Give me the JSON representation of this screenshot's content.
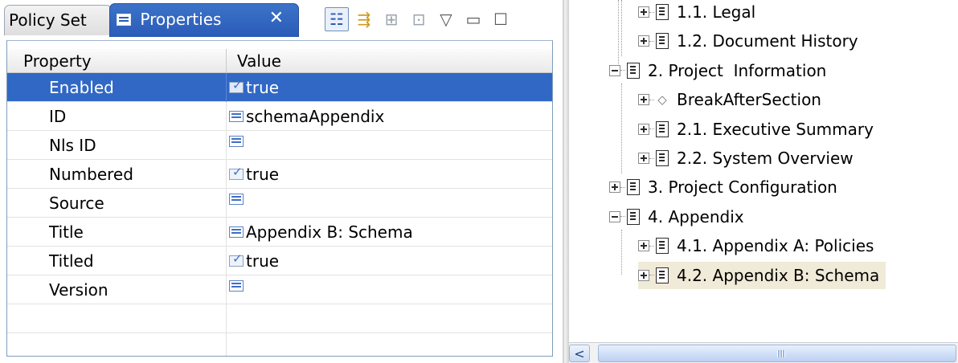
{
  "tabs": {
    "inactive_label": "Policy Set",
    "active_label": "Properties",
    "active_icon": "properties-list-icon",
    "close_glyph": "✕"
  },
  "toolbar": {
    "buttons": [
      {
        "name": "show-categories-icon",
        "glyph": "☷",
        "state": "pressed"
      },
      {
        "name": "show-advanced-icon",
        "glyph": "⇶",
        "state": "enabled"
      },
      {
        "name": "filter-icon",
        "glyph": "⊞",
        "state": "disabled"
      },
      {
        "name": "restore-default-icon",
        "glyph": "⊡",
        "state": "disabled"
      },
      {
        "name": "view-menu-icon",
        "glyph": "▽",
        "state": "enabled"
      },
      {
        "name": "minimize-icon",
        "glyph": "▭",
        "state": "enabled"
      },
      {
        "name": "maximize-icon",
        "glyph": "☐",
        "state": "enabled"
      }
    ]
  },
  "properties": {
    "columns": [
      "Property",
      "Value"
    ],
    "rows": [
      {
        "property": "Enabled",
        "value": "true",
        "icon": "boolean-icon",
        "selected": true
      },
      {
        "property": "ID",
        "value": "schemaAppendix",
        "icon": "text-icon",
        "selected": false
      },
      {
        "property": "Nls ID",
        "value": "",
        "icon": "text-icon",
        "selected": false
      },
      {
        "property": "Numbered",
        "value": "true",
        "icon": "boolean-icon",
        "selected": false
      },
      {
        "property": "Source",
        "value": "",
        "icon": "text-icon",
        "selected": false
      },
      {
        "property": "Title",
        "value": "Appendix B: Schema",
        "icon": "text-icon",
        "selected": false
      },
      {
        "property": "Titled",
        "value": "true",
        "icon": "boolean-icon",
        "selected": false
      },
      {
        "property": "Version",
        "value": "",
        "icon": "text-icon",
        "selected": false
      }
    ]
  },
  "outline": {
    "nodes": [
      {
        "label": "1.1. Legal",
        "level": 2,
        "toggle": "plus",
        "icon": "document-icon"
      },
      {
        "label": "1.2. Document History",
        "level": 2,
        "toggle": "plus",
        "icon": "document-icon"
      },
      {
        "label": "2. Project  Information",
        "level": 1,
        "toggle": "minus",
        "icon": "document-icon"
      },
      {
        "label": "BreakAfterSection",
        "level": 2,
        "toggle": "plus",
        "icon": "diamond-icon"
      },
      {
        "label": "2.1. Executive Summary",
        "level": 2,
        "toggle": "plus",
        "icon": "document-icon"
      },
      {
        "label": "2.2. System Overview",
        "level": 2,
        "toggle": "plus",
        "icon": "document-icon"
      },
      {
        "label": "3. Project Configuration",
        "level": 1,
        "toggle": "plus",
        "icon": "document-icon"
      },
      {
        "label": "4. Appendix",
        "level": 1,
        "toggle": "minus",
        "icon": "document-icon"
      },
      {
        "label": "4.1. Appendix A: Policies",
        "level": 2,
        "toggle": "plus",
        "icon": "document-icon"
      },
      {
        "label": "4.2. Appendix B: Schema",
        "level": 2,
        "toggle": "plus",
        "icon": "document-icon",
        "selected": true
      }
    ]
  },
  "scrollbar": {
    "left_arrow_glyph": "<"
  },
  "colors": {
    "selection": "#3168c5",
    "tab_active": "#2a5bb8",
    "tree_selection": "#f0ead8"
  }
}
